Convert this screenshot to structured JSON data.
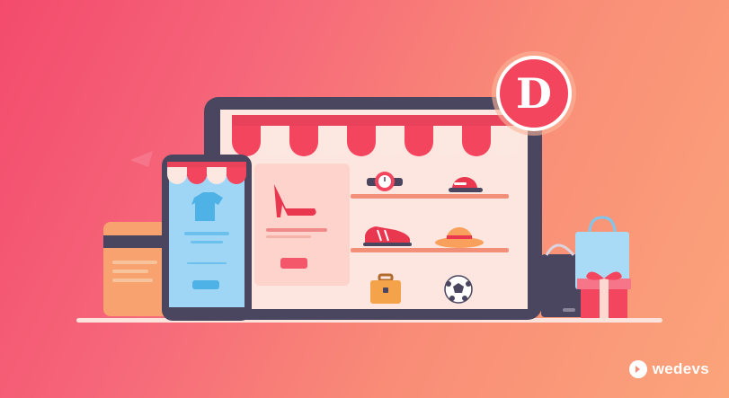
{
  "badge": {
    "letter": "D"
  },
  "brand": {
    "name": "wedevs",
    "icon": "wedevs-logo-icon"
  },
  "colors": {
    "background_start": "#f34b6c",
    "background_end": "#fba47a",
    "device_frame": "#4b4660",
    "awning_red": "#f3455e",
    "awning_cream": "#fde8e1",
    "screen_blue": "#9fd6f5",
    "shelf": "#f28f78"
  },
  "icons": [
    "shop-awning-icon",
    "tablet-icon",
    "phone-icon",
    "credit-card-icon",
    "high-heel-shoe-icon",
    "wristwatch-icon",
    "cap-icon",
    "sneaker-icon",
    "sun-hat-icon",
    "briefcase-icon",
    "soccer-ball-icon",
    "shopping-bag-icon",
    "gift-box-icon",
    "laptop-icon",
    "t-shirt-icon"
  ]
}
